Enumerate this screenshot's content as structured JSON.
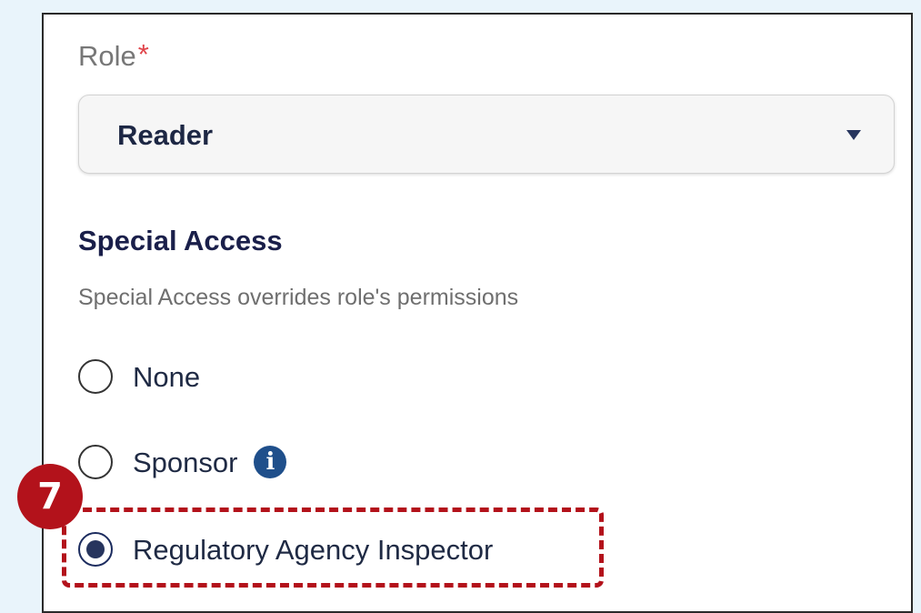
{
  "form": {
    "role": {
      "label": "Role",
      "required_marker": "*",
      "selected_value": "Reader",
      "dropdown_icon": "chevron-down-icon"
    },
    "special_access": {
      "title": "Special Access",
      "description": "Special Access overrides role's permissions",
      "options": [
        {
          "label": "None",
          "checked": false
        },
        {
          "label": "Sponsor",
          "checked": false,
          "icon": "info-icon",
          "icon_glyph": "i"
        },
        {
          "label": "Regulatory Agency Inspector",
          "checked": true
        }
      ]
    }
  },
  "annotation": {
    "step_number": "7",
    "highlight_color": "#b3121b"
  },
  "colors": {
    "background": "#e9f4fb",
    "required": "#e0444a",
    "heading": "#1a1f4a",
    "radio_selected": "#27355e",
    "info_icon": "#1f4f8b"
  }
}
